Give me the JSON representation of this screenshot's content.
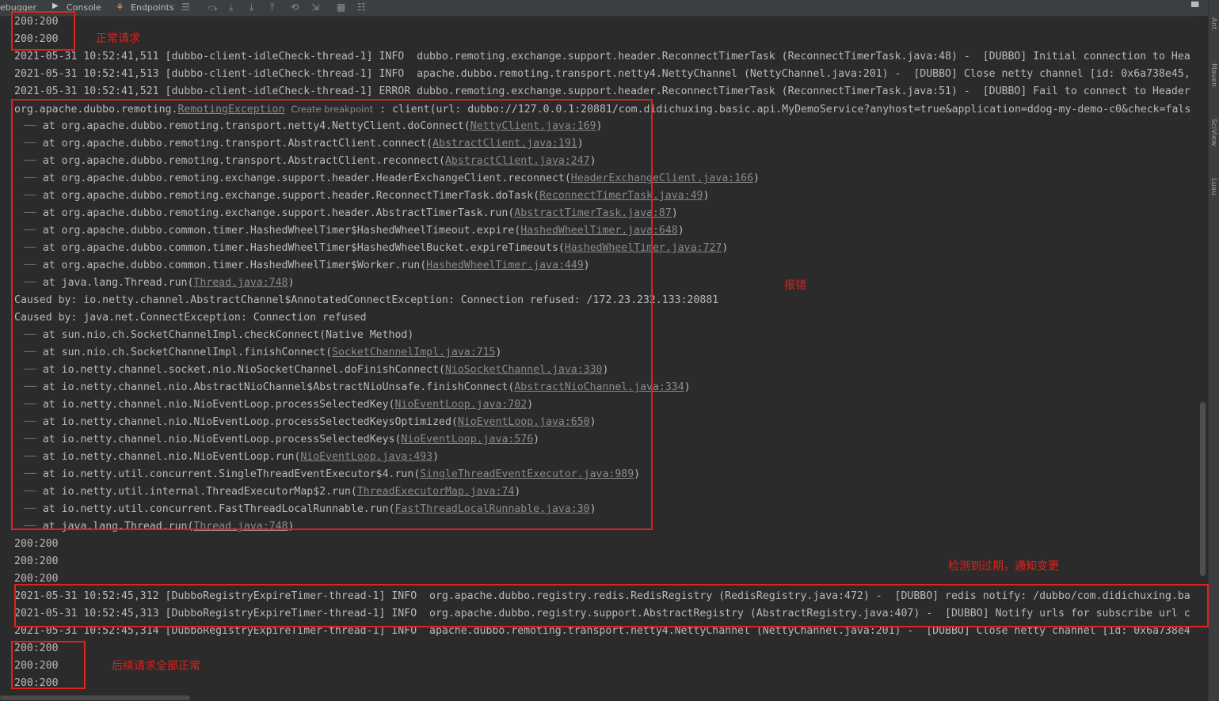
{
  "toolbar": {
    "debugger_tab": "ebugger",
    "console_tab": "Console",
    "endpoints_tab": "Endpoints"
  },
  "right_tabs": {
    "ant": "Ant",
    "maven": "Maven",
    "sciview": "SciView",
    "luau": "Luau"
  },
  "console": {
    "lines": [
      {
        "plain": "200:200"
      },
      {
        "plain": "200:200"
      },
      {
        "plain": "2021-05-31 10:52:41,511 [dubbo-client-idleCheck-thread-1] INFO  dubbo.remoting.exchange.support.header.ReconnectTimerTask (ReconnectTimerTask.java:48) -  [DUBBO] Initial connection to Hea"
      },
      {
        "plain": "2021-05-31 10:52:41,513 [dubbo-client-idleCheck-thread-1] INFO  apache.dubbo.remoting.transport.netty4.NettyChannel (NettyChannel.java:201) -  [DUBBO] Close netty channel [id: 0x6a738e45,"
      },
      {
        "plain": "2021-05-31 10:52:41,521 [dubbo-client-idleCheck-thread-1] ERROR dubbo.remoting.exchange.support.header.ReconnectTimerTask (ReconnectTimerTask.java:51) -  [DUBBO] Fail to connect to Header"
      },
      {
        "pre": "org.apache.dubbo.remoting.",
        "exc": "RemotingException",
        "hint": "Create breakpoint",
        "post": " : client(url: dubbo://127.0.0.1:20881/com.didichuxing.basic.api.MyDemoService?anyhost=true&application=ddog-my-demo-c0&check=fals"
      },
      {
        "at": "org.apache.dubbo.remoting.transport.netty4.NettyClient.doConnect(",
        "link": "NettyClient.java:169"
      },
      {
        "at": "org.apache.dubbo.remoting.transport.AbstractClient.connect(",
        "link": "AbstractClient.java:191"
      },
      {
        "at": "org.apache.dubbo.remoting.transport.AbstractClient.reconnect(",
        "link": "AbstractClient.java:247"
      },
      {
        "at": "org.apache.dubbo.remoting.exchange.support.header.HeaderExchangeClient.reconnect(",
        "link": "HeaderExchangeClient.java:166"
      },
      {
        "at": "org.apache.dubbo.remoting.exchange.support.header.ReconnectTimerTask.doTask(",
        "link": "ReconnectTimerTask.java:49"
      },
      {
        "at": "org.apache.dubbo.remoting.exchange.support.header.AbstractTimerTask.run(",
        "link": "AbstractTimerTask.java:87"
      },
      {
        "at": "org.apache.dubbo.common.timer.HashedWheelTimer$HashedWheelTimeout.expire(",
        "link": "HashedWheelTimer.java:648"
      },
      {
        "at": "org.apache.dubbo.common.timer.HashedWheelTimer$HashedWheelBucket.expireTimeouts(",
        "link": "HashedWheelTimer.java:727"
      },
      {
        "at": "org.apache.dubbo.common.timer.HashedWheelTimer$Worker.run(",
        "link": "HashedWheelTimer.java:449"
      },
      {
        "at": "java.lang.Thread.run(",
        "link": "Thread.java:748"
      },
      {
        "plain": "Caused by: io.netty.channel.AbstractChannel$AnnotatedConnectException: Connection refused: /172.23.232.133:20881"
      },
      {
        "plain": "Caused by: java.net.ConnectException: Connection refused"
      },
      {
        "at": "sun.nio.ch.SocketChannelImpl.checkConnect(Native Method)"
      },
      {
        "at": "sun.nio.ch.SocketChannelImpl.finishConnect(",
        "link": "SocketChannelImpl.java:715"
      },
      {
        "at": "io.netty.channel.socket.nio.NioSocketChannel.doFinishConnect(",
        "link": "NioSocketChannel.java:330"
      },
      {
        "at": "io.netty.channel.nio.AbstractNioChannel$AbstractNioUnsafe.finishConnect(",
        "link": "AbstractNioChannel.java:334"
      },
      {
        "at": "io.netty.channel.nio.NioEventLoop.processSelectedKey(",
        "link": "NioEventLoop.java:702"
      },
      {
        "at": "io.netty.channel.nio.NioEventLoop.processSelectedKeysOptimized(",
        "link": "NioEventLoop.java:650"
      },
      {
        "at": "io.netty.channel.nio.NioEventLoop.processSelectedKeys(",
        "link": "NioEventLoop.java:576"
      },
      {
        "at": "io.netty.channel.nio.NioEventLoop.run(",
        "link": "NioEventLoop.java:493"
      },
      {
        "at": "io.netty.util.concurrent.SingleThreadEventExecutor$4.run(",
        "link": "SingleThreadEventExecutor.java:989"
      },
      {
        "at": "io.netty.util.internal.ThreadExecutorMap$2.run(",
        "link": "ThreadExecutorMap.java:74"
      },
      {
        "at": "io.netty.util.concurrent.FastThreadLocalRunnable.run(",
        "link": "FastThreadLocalRunnable.java:30"
      },
      {
        "at": "java.lang.Thread.run(",
        "link": "Thread.java:748"
      },
      {
        "plain": "200:200"
      },
      {
        "plain": "200:200"
      },
      {
        "plain": "200:200"
      },
      {
        "plain": "2021-05-31 10:52:45,312 [DubboRegistryExpireTimer-thread-1] INFO  org.apache.dubbo.registry.redis.RedisRegistry (RedisRegistry.java:472) -  [DUBBO] redis notify: /dubbo/com.didichuxing.ba"
      },
      {
        "plain": "2021-05-31 10:52:45,313 [DubboRegistryExpireTimer-thread-1] INFO  org.apache.dubbo.registry.support.AbstractRegistry (AbstractRegistry.java:407) -  [DUBBO] Notify urls for subscribe url c"
      },
      {
        "plain": "2021-05-31 10:52:45,314 [DubboRegistryExpireTimer-thread-1] INFO  apache.dubbo.remoting.transport.netty4.NettyChannel (NettyChannel.java:201) -  [DUBBO] Close netty channel [id: 0x6a738e4"
      },
      {
        "plain": "200:200"
      },
      {
        "plain": "200:200"
      },
      {
        "plain": "200:200"
      }
    ]
  },
  "annotations": {
    "normal_request": "正常请求",
    "error": "报错",
    "expired_notify": "检测到过期，通知变更",
    "all_normal": "后续请求全部正常"
  },
  "colors": {
    "annotation_red": "#e2201c",
    "console_bg": "#2b2b2b",
    "text": "#bababa"
  }
}
